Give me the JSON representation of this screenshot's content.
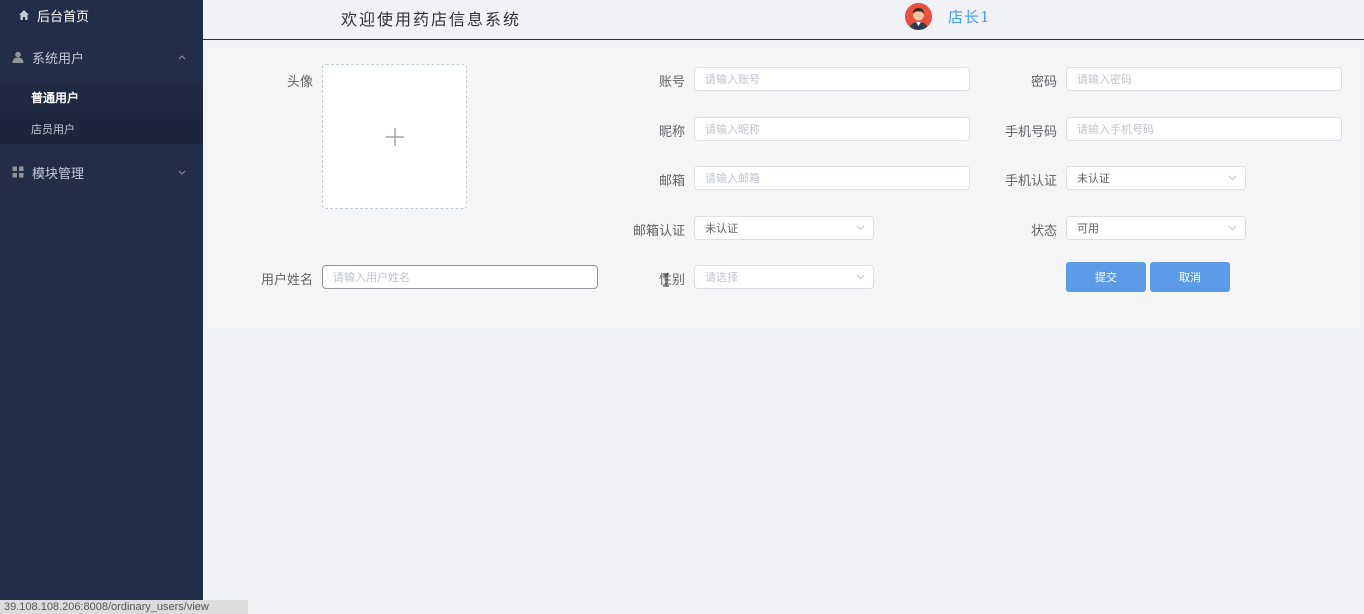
{
  "sidebar": {
    "home_label": "后台首页",
    "groups": [
      {
        "label": "系统用户",
        "expanded": true,
        "icon": "user-icon",
        "items": [
          {
            "label": "普通用户",
            "active": true
          },
          {
            "label": "店员用户",
            "active": false
          }
        ]
      },
      {
        "label": "模块管理",
        "expanded": false,
        "icon": "grid-icon"
      }
    ]
  },
  "header": {
    "title": "欢迎使用药店信息系统",
    "user_name": "店长1"
  },
  "form": {
    "avatar_label": "头像",
    "account": {
      "label": "账号",
      "placeholder": "请输入账号"
    },
    "password": {
      "label": "密码",
      "placeholder": "请输入密码"
    },
    "nickname": {
      "label": "昵称",
      "placeholder": "请输入昵称"
    },
    "phone": {
      "label": "手机号码",
      "placeholder": "请输入手机号码"
    },
    "email": {
      "label": "邮箱",
      "placeholder": "请输入邮箱"
    },
    "phone_verified": {
      "label": "手机认证",
      "value": "未认证"
    },
    "email_verified": {
      "label": "邮箱认证",
      "value": "未认证"
    },
    "status": {
      "label": "状态",
      "value": "可用"
    },
    "real_name": {
      "label": "用户姓名",
      "placeholder": "请输入用户姓名"
    },
    "gender": {
      "label": "性别",
      "placeholder": "请选择"
    },
    "submit_label": "提交",
    "cancel_label": "取消"
  },
  "status_bar": {
    "url": "39.108.108.206:8008/ordinary_users/view"
  },
  "colors": {
    "sidebar_bg": "#222d47",
    "accent": "#409eff",
    "button": "#5b9be6"
  }
}
